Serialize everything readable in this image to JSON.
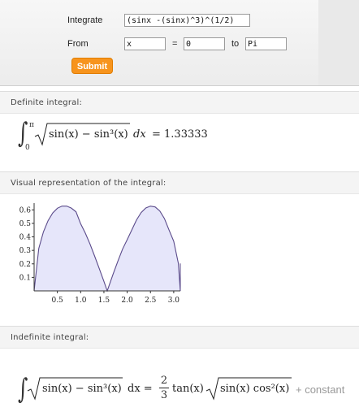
{
  "form": {
    "integrate_label": "Integrate",
    "integrand_value": "(sinx -(sinx)^3)^(1/2)",
    "from_label": "From",
    "variable_value": "x",
    "equals": "=",
    "lower_value": "0",
    "to_label": "to",
    "upper_value": "Pi",
    "submit_label": "Submit"
  },
  "definite": {
    "title": "Definite integral:",
    "upper_limit": "π",
    "lower_limit": "0",
    "integrand": "sin(x) − sin³(x)",
    "dx": "dx",
    "result": "= 1.33333"
  },
  "visual": {
    "title": "Visual representation of the integral:"
  },
  "indefinite": {
    "title": "Indefinite integral:",
    "integrand": "sin(x) − sin³(x)",
    "dx": "dx =",
    "frac_num": "2",
    "frac_den": "3",
    "tan_part": "tan(x)",
    "sqrt_part": "sin(x) cos²(x)",
    "constant": "+ constant"
  },
  "chart_data": {
    "type": "area",
    "function": "sqrt(sin(x) - sin(x)^3)",
    "x": [
      0,
      0.1,
      0.2,
      0.3,
      0.4,
      0.5,
      0.6,
      0.7,
      0.8,
      0.9,
      1.0,
      1.1,
      1.2,
      1.3,
      1.4,
      1.5,
      1.5708,
      1.6,
      1.7,
      1.8,
      1.9,
      2.0,
      2.1,
      2.2,
      2.3,
      2.4,
      2.5,
      2.6,
      2.7,
      2.8,
      2.9,
      3.0,
      3.1,
      3.1416
    ],
    "y": [
      0,
      0.314,
      0.437,
      0.52,
      0.577,
      0.612,
      0.628,
      0.628,
      0.613,
      0.586,
      0.497,
      0.428,
      0.348,
      0.258,
      0.165,
      0.07,
      0,
      0.028,
      0.127,
      0.22,
      0.309,
      0.379,
      0.452,
      0.525,
      0.58,
      0.614,
      0.628,
      0.622,
      0.592,
      0.536,
      0.45,
      0.368,
      0.203,
      0
    ],
    "xticks": [
      "0.5",
      "1.0",
      "1.5",
      "2.0",
      "2.5",
      "3.0"
    ],
    "yticks": [
      "0.1",
      "0.2",
      "0.3",
      "0.4",
      "0.5",
      "0.6"
    ],
    "xlim": [
      0,
      3.1416
    ],
    "ylim": [
      0,
      0.65
    ],
    "fill_color": "#e6e6fa",
    "line_color": "#5a4a8a",
    "grid": false
  }
}
